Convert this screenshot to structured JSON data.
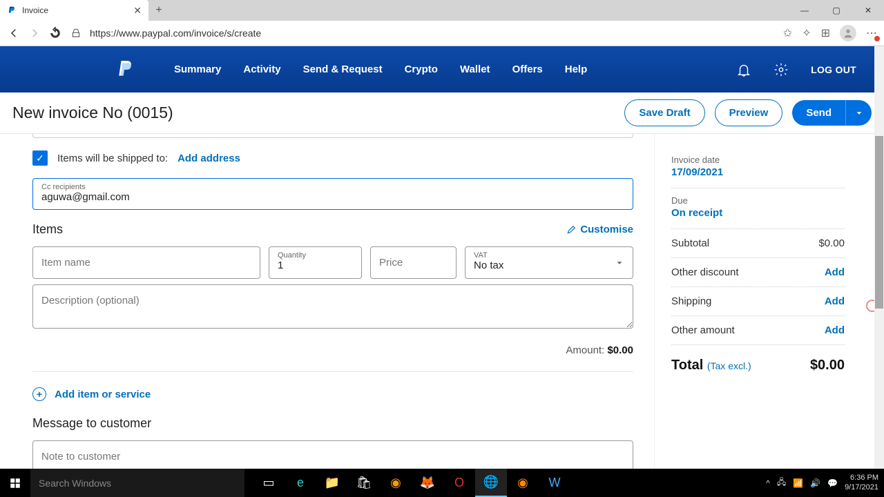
{
  "browser": {
    "tab_title": "Invoice",
    "url": "https://www.paypal.com/invoice/s/create"
  },
  "nav": {
    "summary": "Summary",
    "activity": "Activity",
    "send_request": "Send & Request",
    "crypto": "Crypto",
    "wallet": "Wallet",
    "offers": "Offers",
    "help": "Help",
    "logout": "LOG OUT"
  },
  "page": {
    "title": "New invoice No (0015)",
    "save_draft": "Save Draft",
    "preview": "Preview",
    "send": "Send"
  },
  "form": {
    "ship_label": "Items will be shipped to:",
    "add_address": "Add address",
    "cc_label": "Cc recipients",
    "cc_value": "aguwa@gmail.com",
    "items_heading": "Items",
    "customise": "Customise",
    "item_name_ph": "Item name",
    "quantity_label": "Quantity",
    "quantity_value": "1",
    "price_ph": "Price",
    "vat_label": "VAT",
    "vat_value": "No tax",
    "description_ph": "Description (optional)",
    "amount_label": "Amount:",
    "amount_value": "$0.00",
    "add_item": "Add item or service",
    "message_heading": "Message to customer",
    "note_ph": "Note to customer"
  },
  "summary": {
    "invoice_date_label": "Invoice date",
    "invoice_date": "17/09/2021",
    "due_label": "Due",
    "due_value": "On receipt",
    "subtotal_label": "Subtotal",
    "subtotal_value": "$0.00",
    "other_discount": "Other discount",
    "shipping": "Shipping",
    "other_amount": "Other amount",
    "add": "Add",
    "total_label": "Total",
    "tax_note": "(Tax excl.)",
    "total_value": "$0.00"
  },
  "taskbar": {
    "search_ph": "Search Windows",
    "time": "6:36 PM",
    "date": "9/17/2021"
  }
}
